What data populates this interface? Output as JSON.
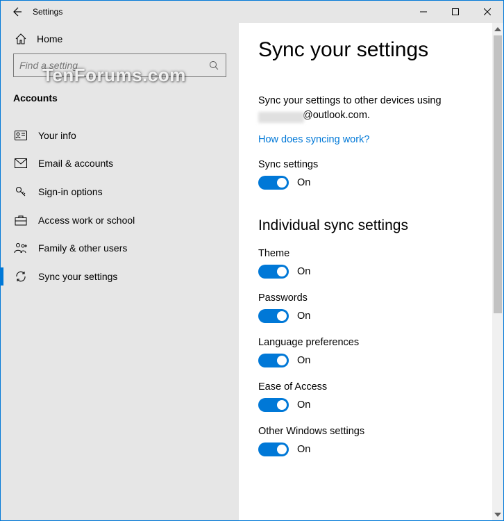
{
  "window": {
    "title": "Settings"
  },
  "sidebar": {
    "home_label": "Home",
    "search_placeholder": "Find a setting",
    "section": "Accounts",
    "items": [
      {
        "label": "Your info",
        "icon": "user-card-icon",
        "active": false
      },
      {
        "label": "Email & accounts",
        "icon": "mail-icon",
        "active": false
      },
      {
        "label": "Sign-in options",
        "icon": "key-icon",
        "active": false
      },
      {
        "label": "Access work or school",
        "icon": "briefcase-icon",
        "active": false
      },
      {
        "label": "Family & other users",
        "icon": "family-icon",
        "active": false
      },
      {
        "label": "Sync your settings",
        "icon": "sync-icon",
        "active": true
      }
    ]
  },
  "main": {
    "title": "Sync your settings",
    "description_prefix": "Sync your settings to other devices using",
    "description_suffix": "@outlook.com.",
    "link": "How does syncing work?",
    "master": {
      "label": "Sync settings",
      "state": "On",
      "on": true
    },
    "subhead": "Individual sync settings",
    "settings": [
      {
        "label": "Theme",
        "state": "On",
        "on": true
      },
      {
        "label": "Passwords",
        "state": "On",
        "on": true
      },
      {
        "label": "Language preferences",
        "state": "On",
        "on": true
      },
      {
        "label": "Ease of Access",
        "state": "On",
        "on": true
      },
      {
        "label": "Other Windows settings",
        "state": "On",
        "on": true
      }
    ]
  },
  "watermark": "TenForums.com",
  "colors": {
    "accent": "#0078d7"
  }
}
